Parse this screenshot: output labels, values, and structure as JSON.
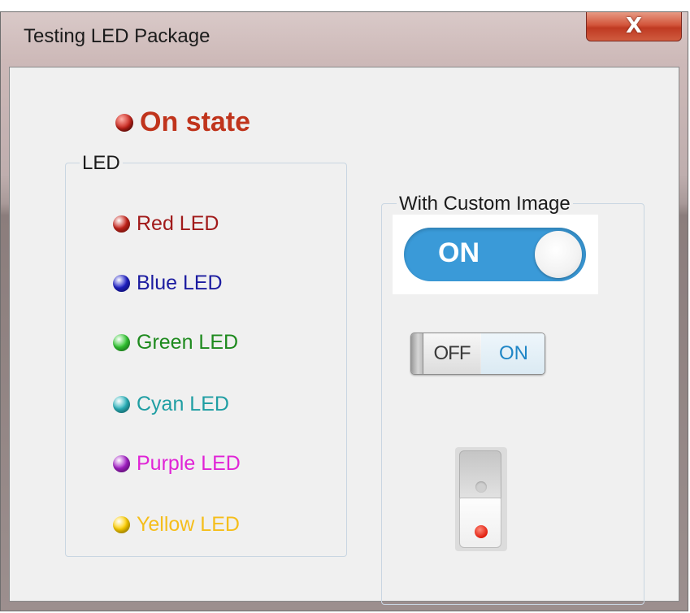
{
  "window": {
    "title": "Testing LED Package",
    "close_label": "X"
  },
  "status": {
    "label": "On state",
    "led_color": "#c8231a",
    "label_color": "#c0341c"
  },
  "led_group": {
    "legend": "LED",
    "items": [
      {
        "label": "Red LED",
        "color": "#c8231a",
        "text_color": "#a11a1a"
      },
      {
        "label": "Blue LED",
        "color": "#1f20c8",
        "text_color": "#1c1ca0"
      },
      {
        "label": "Green LED",
        "color": "#33c933",
        "text_color": "#1e8a1e"
      },
      {
        "label": "Cyan LED",
        "color": "#2ab4bd",
        "text_color": "#1f9ea3"
      },
      {
        "label": "Purple LED",
        "color": "#a51fc8",
        "text_color": "#e024d6"
      },
      {
        "label": "Yellow LED",
        "color": "#ffd000",
        "text_color": "#f5be1b"
      }
    ]
  },
  "custom_group": {
    "legend": "With Custom Image",
    "toggle_large": {
      "label": "ON",
      "color": "#3a9ad8"
    },
    "toggle_small": {
      "off_label": "OFF",
      "on_label": "ON"
    },
    "rocker": {
      "indicator_color": "#e01c0c"
    }
  }
}
